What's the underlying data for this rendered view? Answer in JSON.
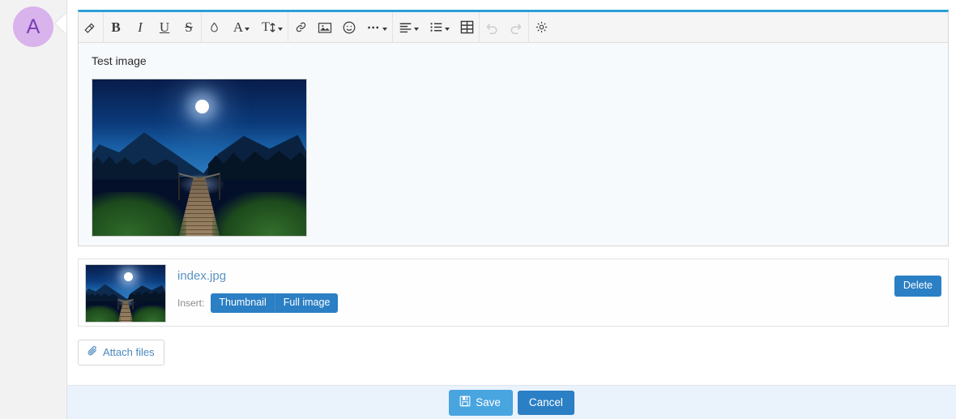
{
  "avatar": {
    "initial": "A"
  },
  "toolbar": {
    "groups": [
      {
        "items": [
          {
            "name": "eraser-icon",
            "label": "",
            "caret": false
          }
        ]
      },
      {
        "items": [
          {
            "name": "bold-icon",
            "label": "B",
            "caret": false
          },
          {
            "name": "italic-icon",
            "label": "I",
            "caret": false
          },
          {
            "name": "underline-icon",
            "label": "U",
            "caret": false
          },
          {
            "name": "strikethrough-icon",
            "label": "S",
            "caret": false
          }
        ]
      },
      {
        "items": [
          {
            "name": "text-color-droplet-icon",
            "label": "",
            "caret": false
          },
          {
            "name": "font-family-icon",
            "label": "A",
            "caret": true
          },
          {
            "name": "font-size-icon",
            "label": "T",
            "caret": true
          }
        ]
      },
      {
        "items": [
          {
            "name": "link-icon",
            "label": "",
            "caret": false
          },
          {
            "name": "image-icon",
            "label": "",
            "caret": false
          },
          {
            "name": "emoji-icon",
            "label": "",
            "caret": false
          },
          {
            "name": "more-options-icon",
            "label": "",
            "caret": true
          }
        ]
      },
      {
        "items": [
          {
            "name": "align-icon",
            "label": "",
            "caret": true
          },
          {
            "name": "list-icon",
            "label": "",
            "caret": true
          },
          {
            "name": "table-icon",
            "label": "",
            "caret": false
          }
        ]
      },
      {
        "items": [
          {
            "name": "undo-icon",
            "label": "",
            "caret": false,
            "disabled": true
          },
          {
            "name": "redo-icon",
            "label": "",
            "caret": false,
            "disabled": true
          }
        ]
      },
      {
        "items": [
          {
            "name": "settings-gear-icon",
            "label": "",
            "caret": false
          }
        ]
      }
    ]
  },
  "editor": {
    "content_text": "Test image",
    "image_alt": "Moonlit lake with wooden pier"
  },
  "attachment": {
    "filename": "index.jpg",
    "insert_label": "Insert:",
    "thumbnail_button": "Thumbnail",
    "full_image_button": "Full image",
    "delete_button": "Delete",
    "thumb_alt": "Moonlit lake with wooden pier"
  },
  "attach_files_button": "Attach files",
  "footer": {
    "save_button": "Save",
    "cancel_button": "Cancel"
  },
  "colors": {
    "accent_blue": "#2b7fc4",
    "save_blue": "#49a5e0",
    "editor_top_border": "#2a9fd6",
    "link_blue": "#5a93c4",
    "avatar_bg": "#d9b3ec",
    "avatar_fg": "#7b3fb5",
    "footer_bg": "#eaf2fb"
  }
}
